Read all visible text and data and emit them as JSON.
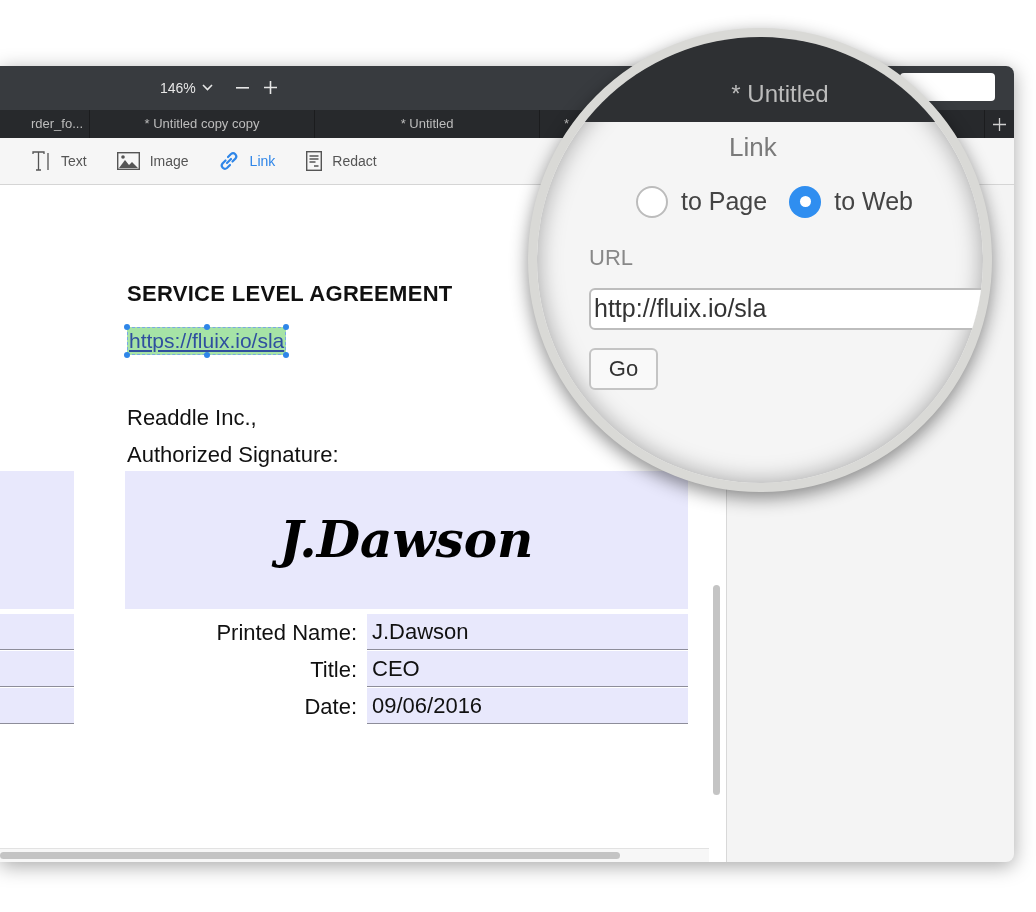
{
  "titlebar": {
    "zoom": "146%",
    "title": "* Untitled"
  },
  "tabs": [
    {
      "label": "rder_fo..."
    },
    {
      "label": "* Untitled copy copy"
    },
    {
      "label": "* Untitled"
    },
    {
      "label": "*"
    }
  ],
  "tools": [
    {
      "kind": "text",
      "label": "Text",
      "selected": false
    },
    {
      "kind": "image",
      "label": "Image",
      "selected": false
    },
    {
      "kind": "link",
      "label": "Link",
      "selected": true
    },
    {
      "kind": "redact",
      "label": "Redact",
      "selected": false
    }
  ],
  "document": {
    "heading": "SERVICE LEVEL AGREEMENT",
    "link": "https://fluix.io/sla",
    "lines": [
      "Readdle Inc.,",
      "Authorized Signature:"
    ],
    "signature": "J.Dawson",
    "fields": [
      {
        "label": "Printed Name:",
        "value": "J.Dawson"
      },
      {
        "label": "Title:",
        "value": "CEO"
      },
      {
        "label": "Date:",
        "value": "09/06/2016"
      }
    ]
  },
  "link_panel": {
    "title": "Link",
    "targets": [
      {
        "label": "to Page",
        "selected": false
      },
      {
        "label": "to Web",
        "selected": true
      }
    ],
    "url_label": "URL",
    "url": "http://fluix.io/sla",
    "button": "Go"
  }
}
